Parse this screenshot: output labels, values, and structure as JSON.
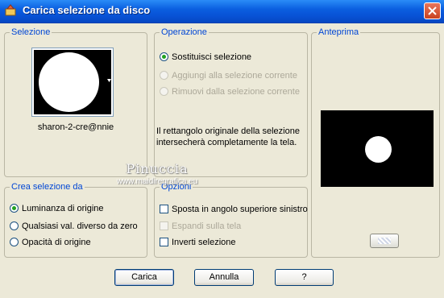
{
  "window": {
    "title": "Carica selezione da disco"
  },
  "selezione": {
    "title": "Selezione",
    "filename": "sharon-2-cre@nnie"
  },
  "operazione": {
    "title": "Operazione",
    "options": [
      {
        "label": "Sostituisci selezione",
        "checked": true,
        "enabled": true
      },
      {
        "label": "Aggiungi alla selezione corrente",
        "checked": false,
        "enabled": false
      },
      {
        "label": "Rimuovi dalla selezione corrente",
        "checked": false,
        "enabled": false
      }
    ],
    "description": "Il rettangolo originale della selezione intersecherà completamente la tela."
  },
  "anteprima": {
    "title": "Anteprima"
  },
  "crea": {
    "title": "Crea selezione da",
    "options": [
      {
        "label": "Luminanza di origine",
        "checked": true
      },
      {
        "label": "Qualsiasi val. diverso da zero",
        "checked": false
      },
      {
        "label": "Opacità di origine",
        "checked": false
      }
    ]
  },
  "opzioni": {
    "title": "Opzioni",
    "items": [
      {
        "label": "Sposta in angolo superiore sinistro",
        "checked": false,
        "enabled": true
      },
      {
        "label": "Espandi sulla tela",
        "checked": false,
        "enabled": false
      },
      {
        "label": "Inverti selezione",
        "checked": false,
        "enabled": true
      }
    ]
  },
  "watermark": {
    "line1": "Pinuccia",
    "line2": "www.maidiregrafica.eu"
  },
  "buttons": {
    "carica": "Carica",
    "annulla": "Annulla",
    "help": "?"
  }
}
